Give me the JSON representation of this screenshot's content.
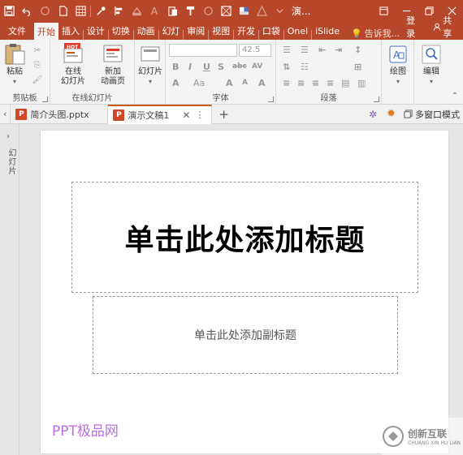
{
  "window": {
    "title": "演..."
  },
  "ribbon_tabs": [
    {
      "label": "文件"
    },
    {
      "label": "开始"
    },
    {
      "label": "插入"
    },
    {
      "label": "设计"
    },
    {
      "label": "切换"
    },
    {
      "label": "动画"
    },
    {
      "label": "幻灯"
    },
    {
      "label": "审阅"
    },
    {
      "label": "视图"
    },
    {
      "label": "开发"
    },
    {
      "label": "口袋"
    },
    {
      "label": "Onel"
    },
    {
      "label": "iSlide"
    }
  ],
  "tell_me": "告诉我...",
  "login_label": "登录",
  "share_label": "共享",
  "ribbon": {
    "clipboard": {
      "paste_label": "粘贴",
      "group_label": "剪贴板"
    },
    "online_slides": {
      "online_label_1": "在线",
      "online_label_2": "幻灯片",
      "new_label_1": "新加",
      "new_label_2": "动画页",
      "hot_badge": "HOT",
      "group_label": "在线幻灯片"
    },
    "slides": {
      "label": "幻灯片"
    },
    "font": {
      "font_name": "",
      "font_size": "42.5",
      "group_label": "字体"
    },
    "paragraph": {
      "group_label": "段落"
    },
    "drawing": {
      "label": "绘图"
    },
    "editing": {
      "label": "编辑"
    }
  },
  "doc_tabs": [
    {
      "label": "简介头图.pptx",
      "active": false
    },
    {
      "label": "演示文稿1",
      "active": true
    }
  ],
  "multi_window_label": "多窗口模式",
  "side_pane_label": "幻灯片",
  "slide": {
    "title_placeholder": "单击此处添加标题",
    "subtitle_placeholder": "单击此处添加副标题"
  },
  "watermarks": {
    "left": "PPT极品网",
    "right_cn": "创新互联",
    "right_en": "CHUANG XIN HU LIAN"
  },
  "colors": {
    "accent": "#b7472a",
    "watermark": "#b86ee0"
  }
}
